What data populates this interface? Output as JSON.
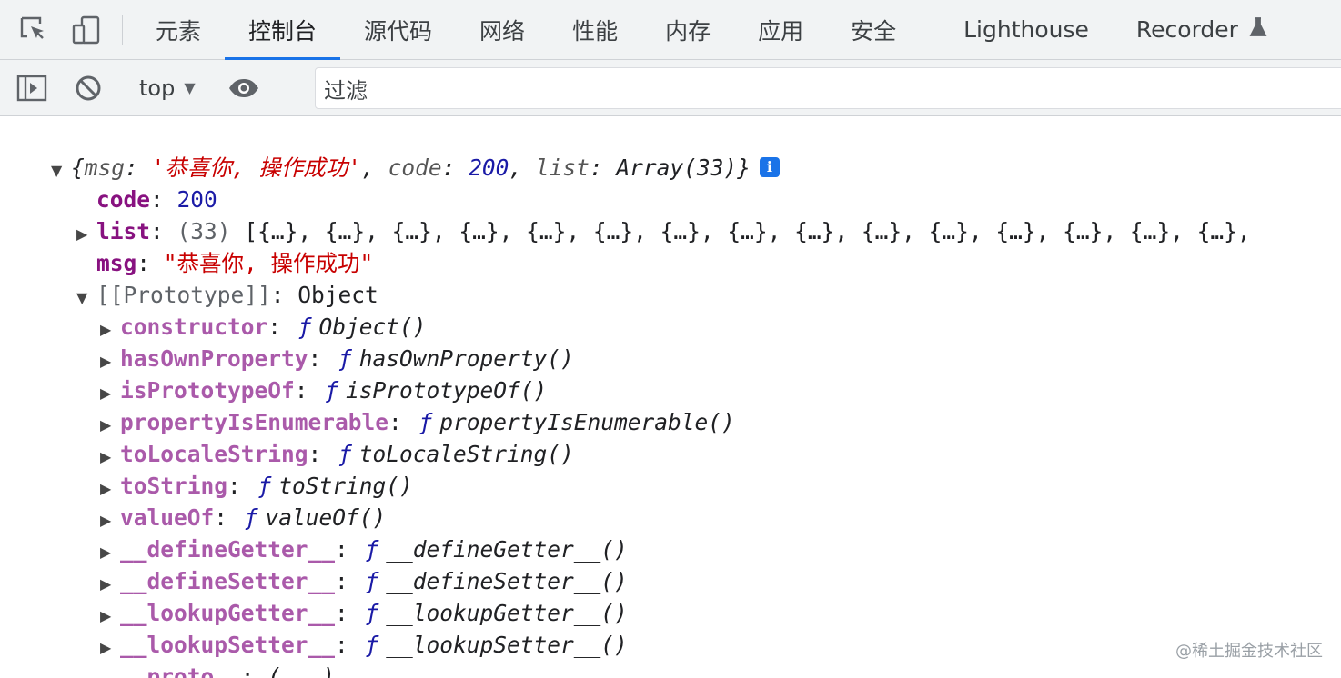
{
  "tabs": [
    {
      "label": "元素"
    },
    {
      "label": "控制台",
      "active": true
    },
    {
      "label": "源代码"
    },
    {
      "label": "网络"
    },
    {
      "label": "性能"
    },
    {
      "label": "内存"
    },
    {
      "label": "应用"
    },
    {
      "label": "安全"
    },
    {
      "label": "Lighthouse"
    },
    {
      "label": "Recorder"
    }
  ],
  "toolbar": {
    "context": "top",
    "filter_placeholder": "过滤"
  },
  "console": {
    "summary": {
      "open": "{",
      "msg_key": "msg",
      "msg_val": "'恭喜你, 操作成功'",
      "code_key": "code",
      "code_val": "200",
      "list_key": "list",
      "list_val": "Array(33)",
      "close": "}"
    },
    "code": {
      "key": "code",
      "value": "200"
    },
    "list": {
      "key": "list",
      "count": "(33)",
      "preview": "[{…}, {…}, {…}, {…}, {…}, {…}, {…}, {…}, {…}, {…}, {…}, {…}, {…}, {…}, {…},"
    },
    "msg": {
      "key": "msg",
      "value": "\"恭喜你, 操作成功\""
    },
    "prototype": {
      "key": "[[Prototype]]",
      "value": "Object"
    },
    "proto_members": [
      {
        "key": "constructor",
        "fn": "Object()"
      },
      {
        "key": "hasOwnProperty",
        "fn": "hasOwnProperty()"
      },
      {
        "key": "isPrototypeOf",
        "fn": "isPrototypeOf()"
      },
      {
        "key": "propertyIsEnumerable",
        "fn": "propertyIsEnumerable()"
      },
      {
        "key": "toLocaleString",
        "fn": "toLocaleString()"
      },
      {
        "key": "toString",
        "fn": "toString()"
      },
      {
        "key": "valueOf",
        "fn": "valueOf()"
      },
      {
        "key": "__defineGetter__",
        "fn": "__defineGetter__()"
      },
      {
        "key": "__defineSetter__",
        "fn": "__defineSetter__()"
      },
      {
        "key": "__lookupGetter__",
        "fn": "__lookupGetter__()"
      },
      {
        "key": "__lookupSetter__",
        "fn": "__lookupSetter__()"
      },
      {
        "key": "__proto__",
        "fn": "(...)"
      }
    ],
    "f_symbol": "ƒ"
  },
  "watermark": "@稀土掘金技术社区"
}
